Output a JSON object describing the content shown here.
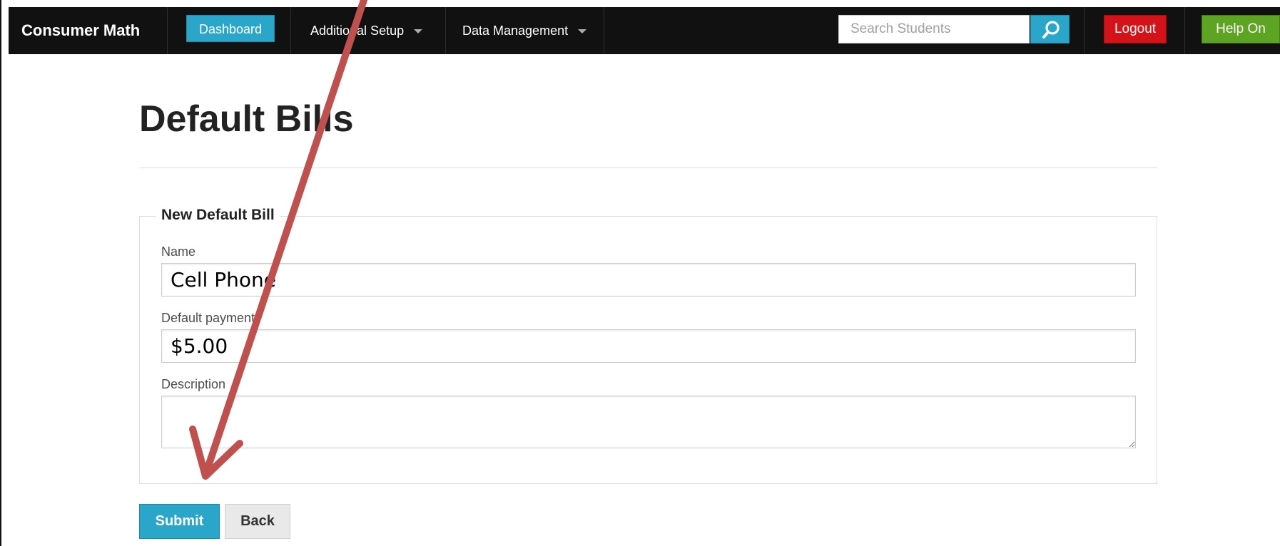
{
  "topbar": {
    "brand": "Consumer Math",
    "dashboard_label": "Dashboard",
    "menu_additional_setup": "Additional Setup",
    "menu_data_management": "Data Management",
    "search_placeholder": "Search Students",
    "search_icon": "search-icon",
    "logout_label": "Logout",
    "help_label": "Help On"
  },
  "page": {
    "title": "Default Bills",
    "form": {
      "legend": "New Default Bill",
      "name_label": "Name",
      "name_value": "Cell Phone",
      "payment_label": "Default payment",
      "payment_value": "$5.00",
      "description_label": "Description",
      "description_value": "",
      "submit_label": "Submit",
      "back_label": "Back"
    }
  },
  "colors": {
    "topbar_bg": "#111111",
    "primary": "#2ba6cb",
    "logout": "#d4121a",
    "help": "#5da423",
    "annotation_arrow": "#c0504d"
  }
}
